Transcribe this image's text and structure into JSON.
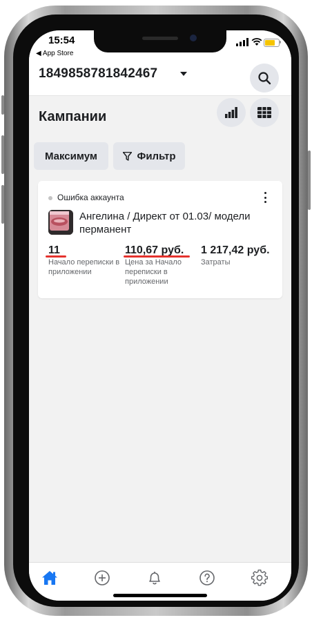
{
  "status_bar": {
    "time": "15:54",
    "back_app": "◀ App Store"
  },
  "header": {
    "account_id": "1849858781842467"
  },
  "section": {
    "title": "Кампании"
  },
  "filters": {
    "objective_label": "Максимум",
    "filter_label": "Фильтр"
  },
  "campaign": {
    "status": "Ошибка аккаунта",
    "name": "Ангелина / Директ от 01.03/ модели перманент",
    "metrics": [
      {
        "value": "11",
        "label": "Начало переписки в приложении"
      },
      {
        "value": "110,67 руб.",
        "label": "Цена за Начало переписки в приложении"
      },
      {
        "value": "1 217,42 руб.",
        "label": "Затраты"
      }
    ]
  },
  "tabbar": {
    "items": [
      "home-icon",
      "plus-circle-icon",
      "bell-icon",
      "help-icon",
      "gear-icon"
    ]
  },
  "colors": {
    "accent": "#1877f2",
    "annotation": "#e5322d",
    "chip": "#e4e6eb",
    "battery": "#f5c400"
  }
}
